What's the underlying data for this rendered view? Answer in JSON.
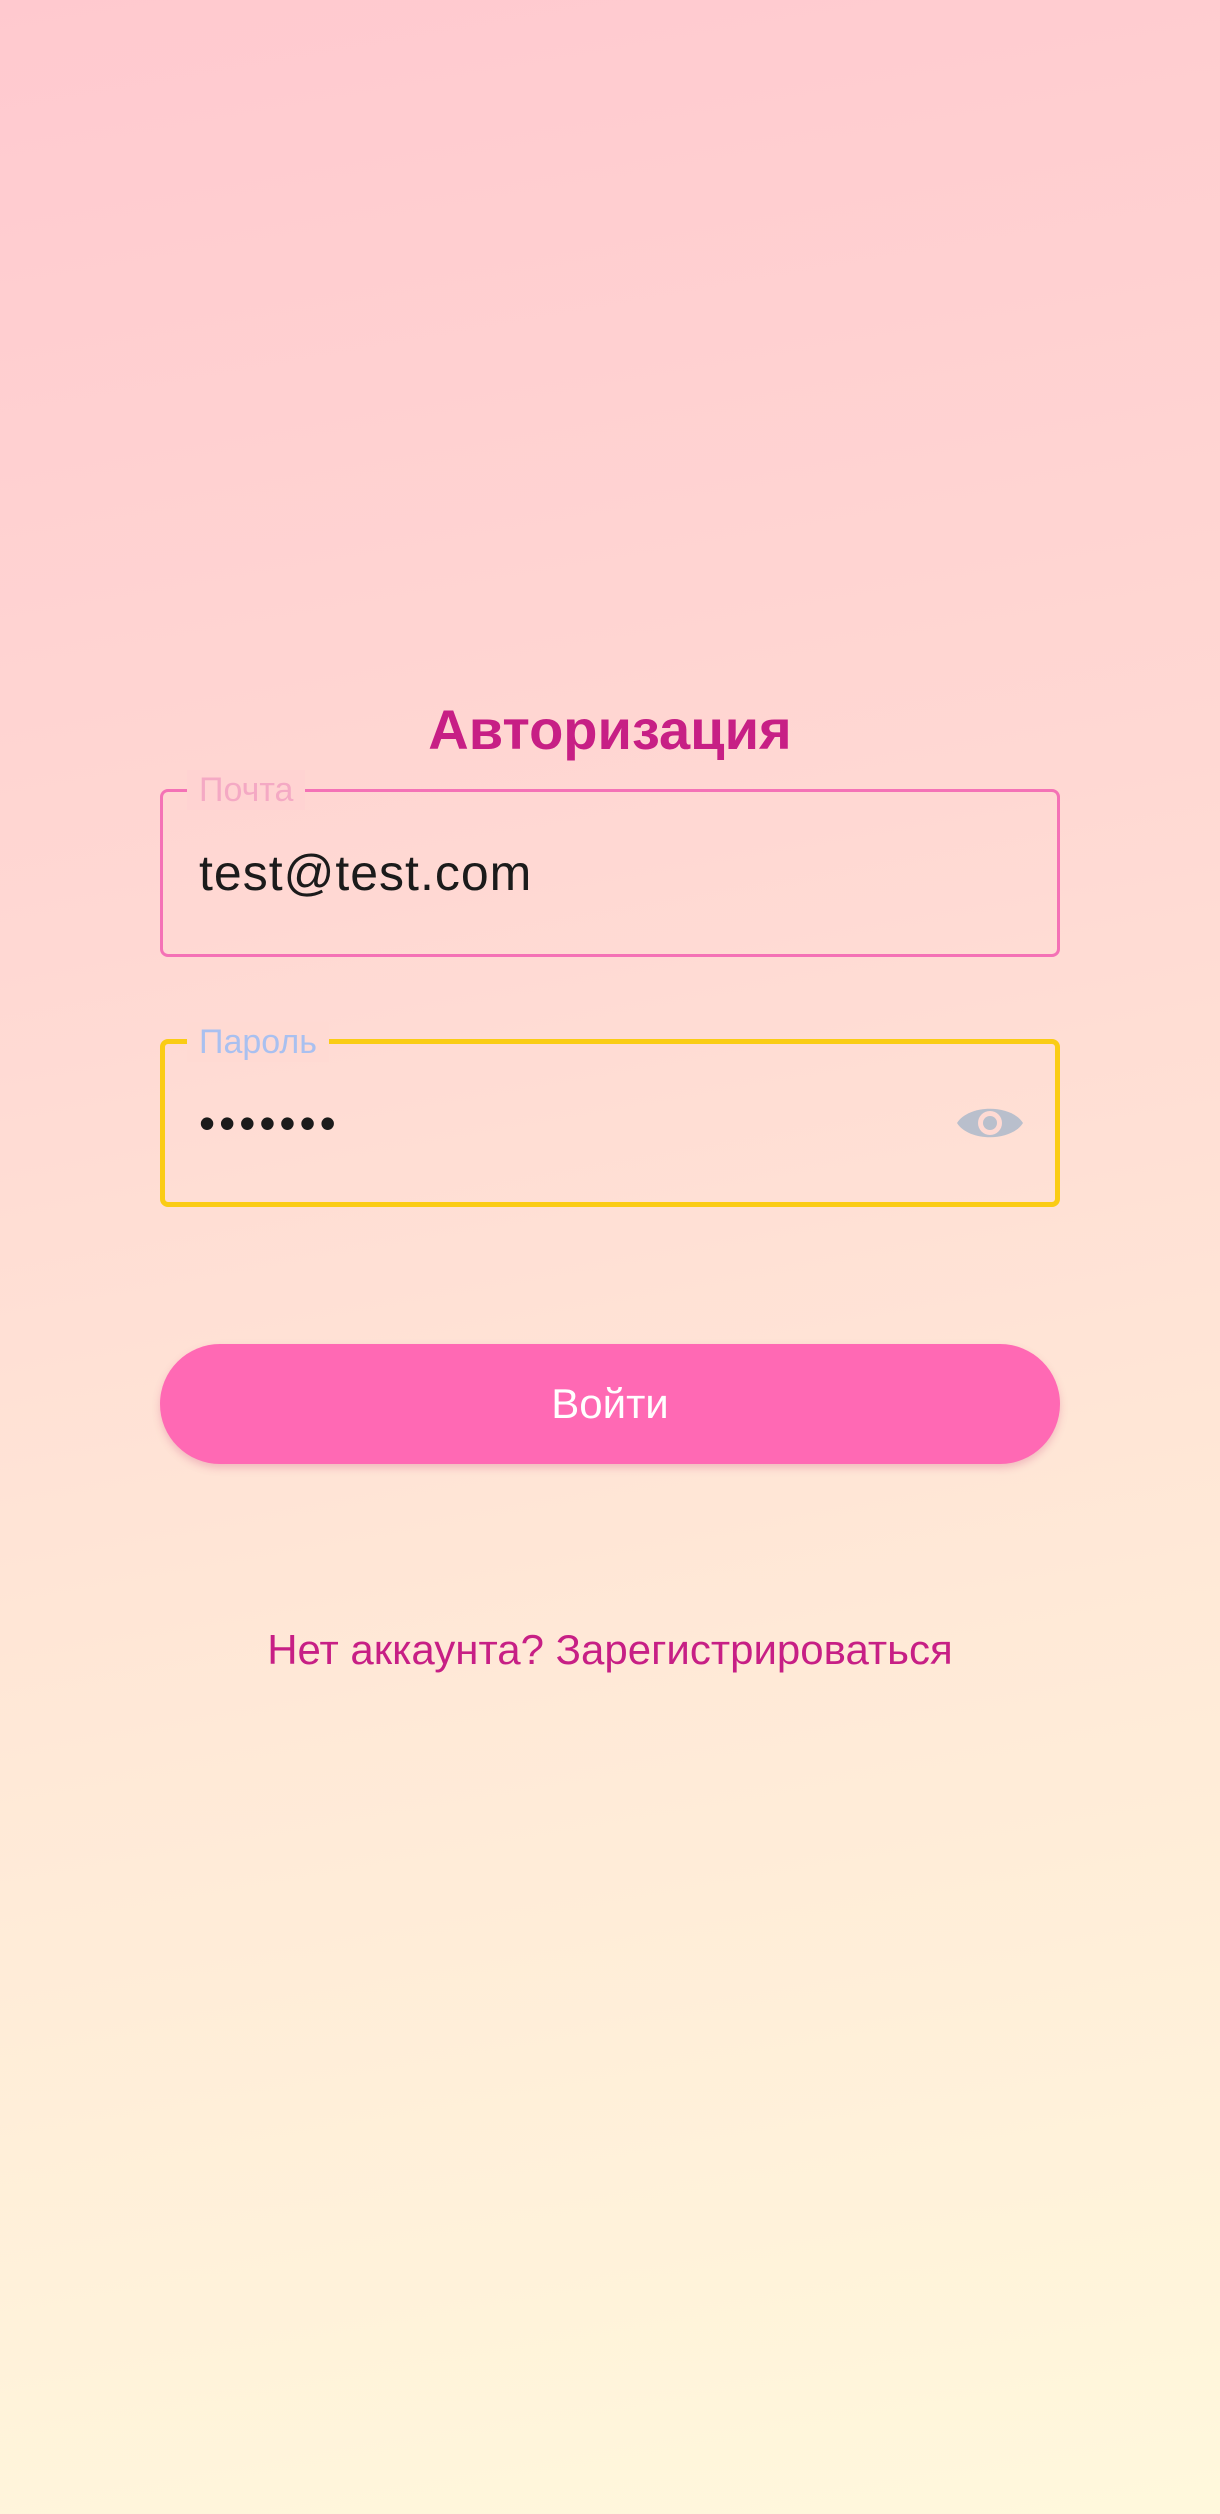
{
  "screen": {
    "title": "Авторизация"
  },
  "form": {
    "email": {
      "label": "Почта",
      "value": "test@test.com"
    },
    "password": {
      "label": "Пароль",
      "value": "•••••••",
      "toggle_icon": "eye-icon"
    },
    "login_label": "Войти",
    "register_link": "Нет аккаунта? Зарегистрироваться"
  },
  "colors": {
    "accent": "#c71f85",
    "button": "#ff69b4",
    "email_border": "#f472b6",
    "password_border_focused": "#facc15"
  }
}
